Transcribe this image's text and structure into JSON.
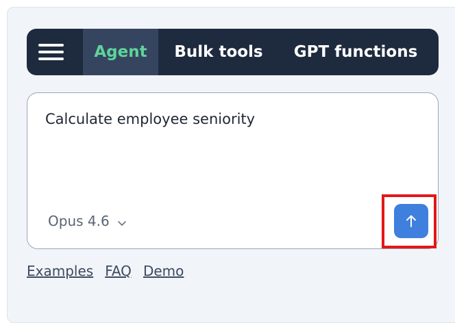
{
  "tabs": [
    {
      "label": "Agent",
      "active": true
    },
    {
      "label": "Bulk tools",
      "active": false
    },
    {
      "label": "GPT functions",
      "active": false
    }
  ],
  "menu": {
    "icon": "hamburger-icon"
  },
  "prompt": {
    "value": "Calculate employee seniority"
  },
  "model": {
    "selected": "Opus 4.6",
    "icon": "chevron-down-icon"
  },
  "send": {
    "icon": "arrow-up-icon"
  },
  "links": [
    {
      "label": "Examples"
    },
    {
      "label": "FAQ"
    },
    {
      "label": "Demo"
    }
  ],
  "colors": {
    "tabbar_bg": "#1e2a3d",
    "active_tab_bg": "#354560",
    "active_tab_text": "#5fd39a",
    "send_button": "#3f7fdd",
    "highlight": "#e21717",
    "panel_bg": "#f1f4f9"
  }
}
